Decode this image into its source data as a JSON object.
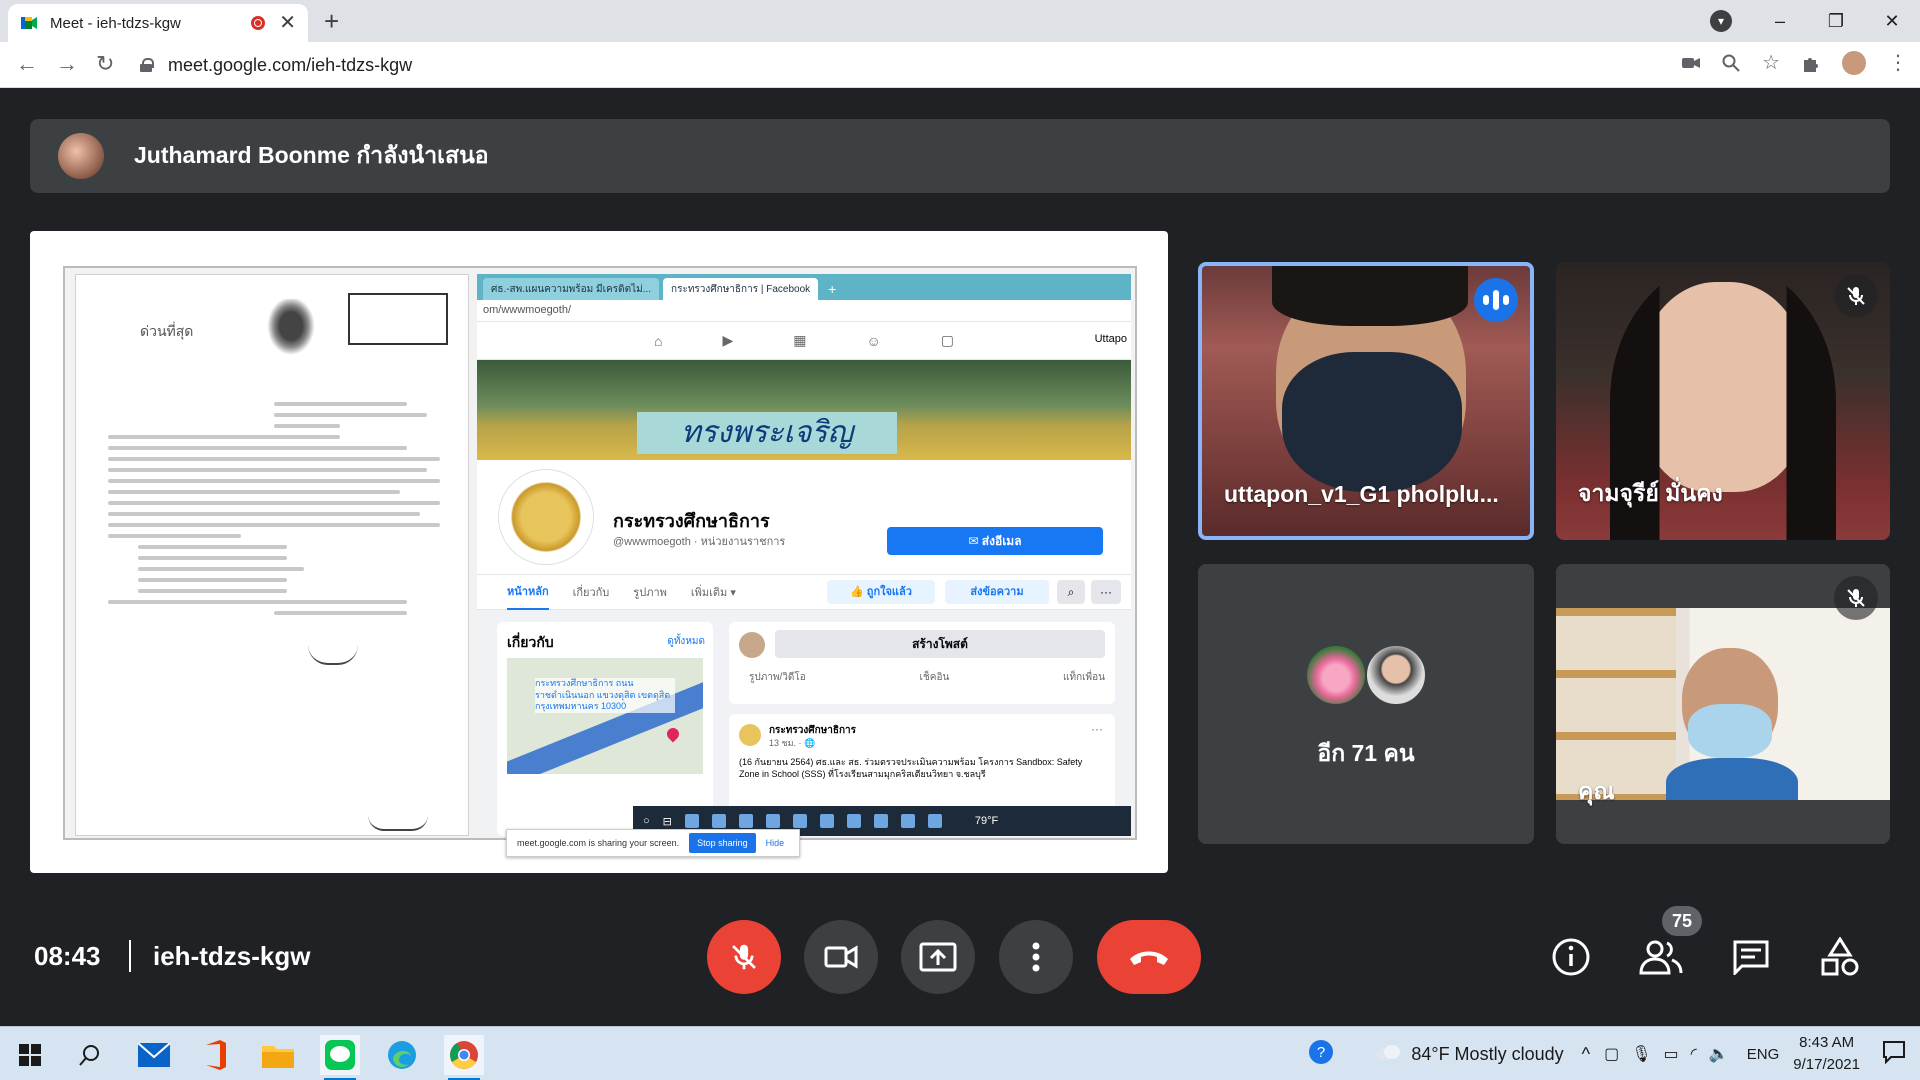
{
  "browser": {
    "tab_title": "Meet - ieh-tdzs-kgw",
    "tab_close": "✕",
    "new_tab": "+",
    "url": "meet.google.com/ieh-tdzs-kgw",
    "window_controls": [
      "–",
      "❐",
      "✕"
    ]
  },
  "presenter": {
    "text": "Juthamard Boonme กำลังนำเสนอ"
  },
  "shared_screen": {
    "document": {
      "urgent_label": "ด่วนที่สุด"
    },
    "facebook": {
      "tabs": [
        "ศธ.-สพ.แผนความพร้อม มีเครดิตไม่...",
        "กระทรวงศึกษาธิการ | Facebook"
      ],
      "new_tab": "+",
      "url": "om/wwwmoegoth/",
      "me_label": "Uttapo",
      "cover_text": "ทรงพระเจริญ",
      "page_name": "กระทรวงศึกษาธิการ",
      "handle": "@wwwmoegoth · หน่วยงานราชการ",
      "email_button": "✉ ส่งอีเมล",
      "tabs2": [
        "หน้าหลัก",
        "เกี่ยวกับ",
        "รูปภาพ",
        "เพิ่มเติม ▾"
      ],
      "like_button": "👍 ถูกใจแล้ว",
      "message_button": "ส่งข้อความ",
      "about_title": "เกี่ยวกับ",
      "about_all": "ดูทั้งหมด",
      "address": "กระทรวงศึกษาธิการ ถนนราชดำเนินนอก แขวงดุสิต เขตดุสิต กรุงเทพมหานคร 10300",
      "create_post": "สร้างโพสต์",
      "post_actions": [
        "รูปภาพ/วิดีโอ",
        "เช็คอิน",
        "แท็กเพื่อน"
      ],
      "feed_name": "กระทรวงศึกษาธิการ",
      "feed_time": "13 ชม. · 🌐",
      "feed_text": "(16 กันยายน 2564) ศธ.และ สธ. ร่วมตรวจประเมินความพร้อม โครงการ Sandbox: Safety Zone in School (SSS) ที่โรงเรียนสามมุกคริสเตียนวิทยา จ.ชลบุรี",
      "more": "···",
      "weather_mini": "79°F"
    },
    "share_notice": {
      "text": "meet.google.com is sharing your screen.",
      "stop": "Stop sharing",
      "hide": "Hide"
    }
  },
  "participants": {
    "tile1_name": "uttapon_v1_G1 pholplu...",
    "tile2_name": "จามจุรีย์ มั่นคง",
    "tile3_more": "อีก 71 คน",
    "tile4_name": "คุณ"
  },
  "meeting": {
    "time": "08:43",
    "code": "ieh-tdzs-kgw",
    "participant_count": "75"
  },
  "taskbar": {
    "weather": "84°F  Mostly cloudy",
    "lang": "ENG",
    "time": "8:43 AM",
    "date": "9/17/2021"
  },
  "colors": {
    "meet_bg": "#202124",
    "tile_bg": "#3c4043",
    "red": "#ea4335",
    "speaking_blue": "#1a73e8",
    "active_border": "#8ab4f8"
  }
}
